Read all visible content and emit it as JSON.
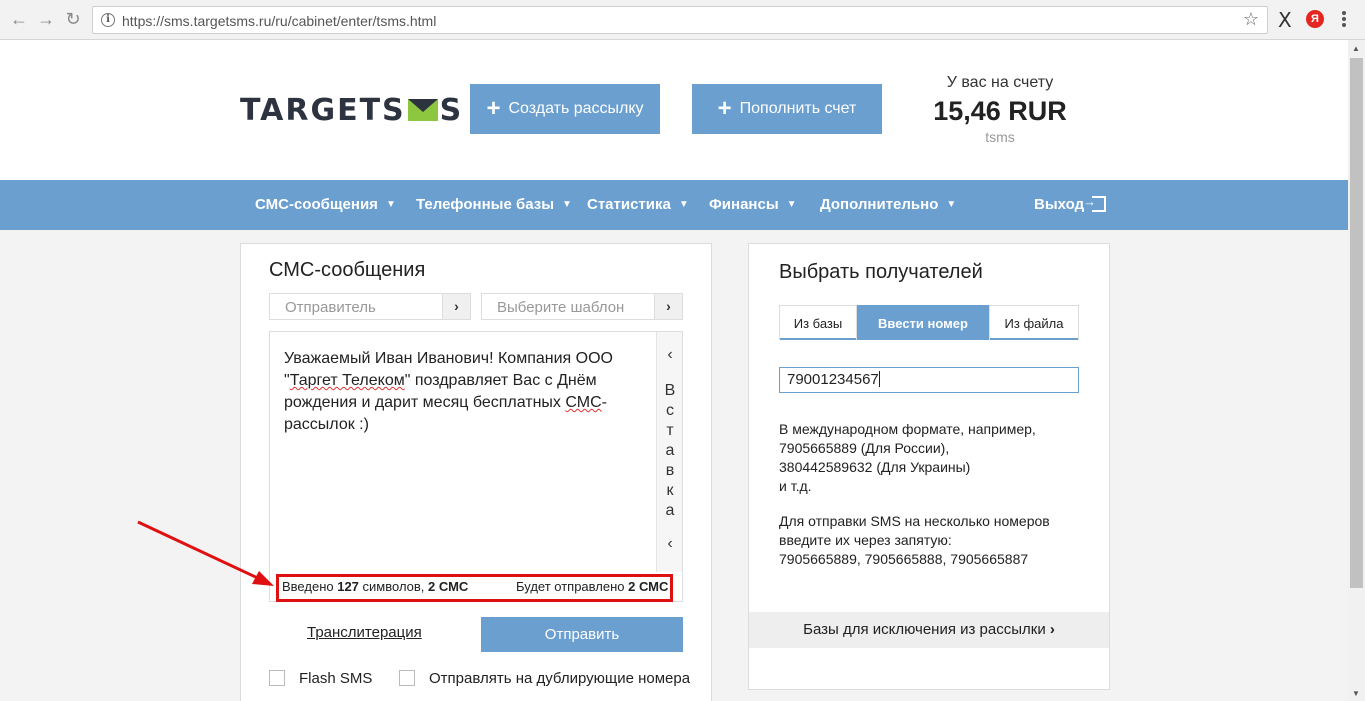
{
  "browser": {
    "url": "https://sms.targetsms.ru/ru/cabinet/enter/tsms.html",
    "back_icon": "←",
    "forward_icon": "→",
    "reload_icon": "↻",
    "star_icon": "☆",
    "ext_x": "X",
    "ext_ya": "Я"
  },
  "header": {
    "logo_left": "TARGETS",
    "logo_right": "S",
    "create_button": "Создать рассылку",
    "topup_button": "Пополнить счет",
    "plus": "+",
    "balance_label": "У вас на счету",
    "balance_amount": "15,46 RUR",
    "account_login": "tsms"
  },
  "nav": {
    "items": [
      "СМС-сообщения",
      "Телефонные базы",
      "Статистика",
      "Финансы",
      "Дополнительно"
    ],
    "chevron": "⌄",
    "logout": "Выход"
  },
  "sms_panel": {
    "title": "СМС-сообщения",
    "sender_placeholder": "Отправитель",
    "template_placeholder": "Выберите шаблон",
    "message_line1": "Уважаемый Иван Иванович! Компания ООО",
    "message_line2_pre": "\"",
    "message_line2_spell": "Таргет Телеком",
    "message_line2_post": "\" поздравляет Вас с Днём",
    "message_line3_pre": "рождения и дарит месяц бесплатных ",
    "message_line3_spell": "СМС",
    "message_line3_post": "-",
    "message_line4": "рассылок :)",
    "insert_letters": [
      "В",
      "с",
      "т",
      "а",
      "в",
      "к",
      "а"
    ],
    "insert_chevron": "‹",
    "counter_prefix": "Введено ",
    "counter_chars": "127",
    "counter_mid": " символов, ",
    "counter_sms": "2 СМС",
    "will_send_prefix": "Будет отправлено ",
    "will_send_value": "2 СМС",
    "translit": "Транслитерация",
    "send_button": "Отправить",
    "flash_sms": "Flash SMS",
    "duplicate_numbers": "Отправлять на дублирующие номера"
  },
  "recipients_panel": {
    "title": "Выбрать получателей",
    "tabs": [
      "Из базы",
      "Ввести номер",
      "Из файла"
    ],
    "active_tab": 1,
    "phone_value": "79001234567",
    "hint1_lines": [
      "В международном формате, например,",
      "7905665889 (Для России),",
      "380442589632 (Для Украины)",
      "и т.д."
    ],
    "hint2_lines": [
      "Для отправки SMS на несколько номеров",
      "введите их через запятую:",
      "7905665889, 7905665888, 7905665887"
    ],
    "exclusion": "Базы для исключения из рассылки",
    "exclusion_chevron": "›"
  },
  "colors": {
    "brand_blue": "#6a9fd0",
    "logo_green": "#8dc63f",
    "annotation_red": "#e01010"
  }
}
